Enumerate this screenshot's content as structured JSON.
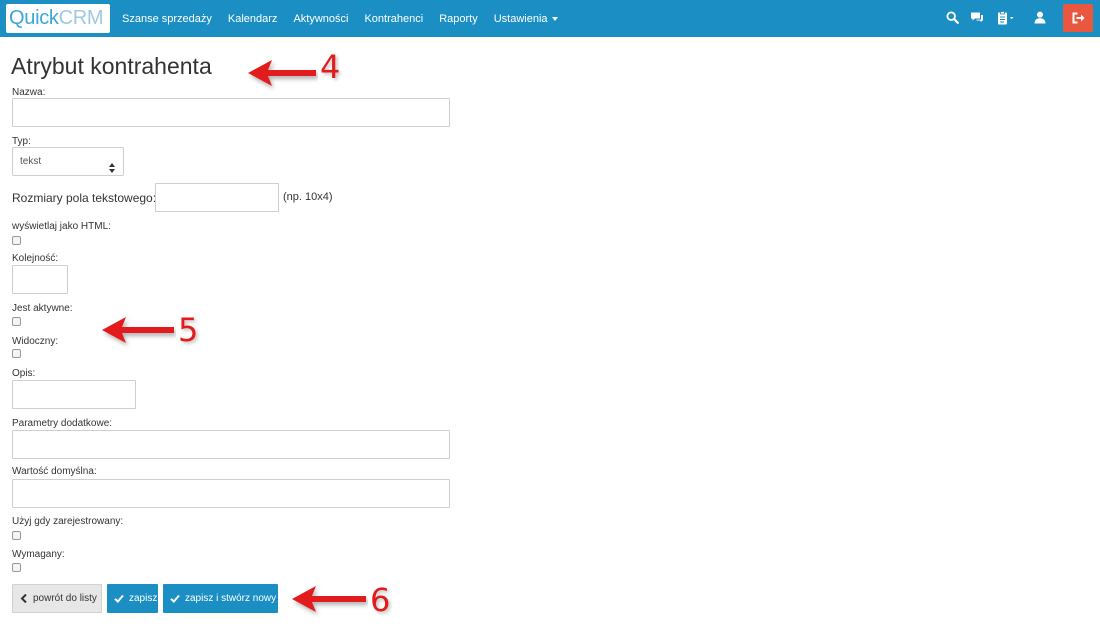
{
  "navbar": {
    "logo": {
      "part1": "Quick",
      "part2": "CRM"
    },
    "menu": [
      {
        "label": "Szanse sprzedaży"
      },
      {
        "label": "Kalendarz"
      },
      {
        "label": "Aktywności"
      },
      {
        "label": "Kontrahenci"
      },
      {
        "label": "Raporty"
      },
      {
        "label": "Ustawienia"
      }
    ],
    "icons": [
      "search-icon",
      "chat-icon",
      "clipboard-icon",
      "user-icon",
      "logout-icon"
    ],
    "accent": "#1b8fc4",
    "logout_color": "#e9573f"
  },
  "form": {
    "title": "Atrybut kontrahenta",
    "name_label": "Nazwa:",
    "name_value": "",
    "type_label": "Typ:",
    "type_value": "tekst",
    "size_label": "Rozmiary pola tekstowego:",
    "size_hint": "(np. 10x4)",
    "html_label": "wyświetlaj jako HTML:",
    "order_label": "Kolejność:",
    "active_label": "Jest aktywne:",
    "visible_label": "Widoczny:",
    "description_label": "Opis:",
    "extra_params_label": "Parametry dodatkowe:",
    "default_value_label": "Wartość domyślna:",
    "use_registered_label": "Użyj gdy zarejestrowany:",
    "required_label": "Wymagany:"
  },
  "buttons": {
    "back": "powrót do listy",
    "save": "zapisz",
    "save_new": "zapisz i stwórz nowy"
  },
  "annotations": {
    "n4": "4",
    "n5": "5",
    "n6": "6",
    "color": "#e21b1b"
  }
}
